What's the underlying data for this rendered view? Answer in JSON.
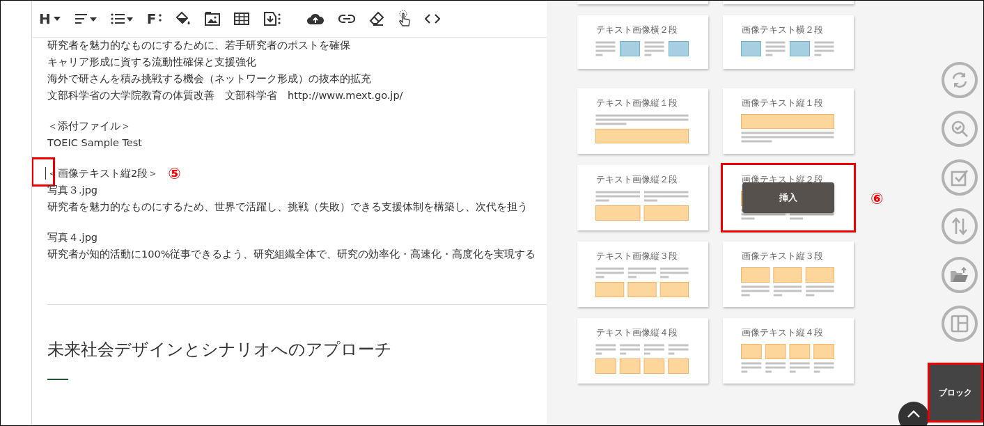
{
  "toolbar": {
    "heading_label": "H",
    "font_label": "F"
  },
  "editor": {
    "paragraphs": [
      {
        "lines": [
          {
            "text": "研究者を魅力的なものにするために、若手研究者のポストを確保",
            "caret": false,
            "highlighted": false
          },
          {
            "text": "キャリア形成に資する流動性確保と支援強化",
            "caret": false,
            "highlighted": false
          },
          {
            "text": "海外で研さんを積み挑戦する機会（ネットワーク形成）の抜本的拡充",
            "caret": false,
            "highlighted": false
          },
          {
            "text": "文部科学省の大学院教育の体質改善　文部科学省　http://www.mext.go.jp/",
            "caret": false,
            "highlighted": false
          }
        ]
      },
      {
        "lines": [
          {
            "text": "＜添付ファイル＞",
            "caret": false,
            "highlighted": false
          },
          {
            "text": "TOEIC Sample Test",
            "caret": false,
            "highlighted": false
          }
        ]
      },
      {
        "lines": [
          {
            "text": "＜画像テキスト縦2段＞",
            "caret": true,
            "highlighted": true,
            "callout": "⑤"
          },
          {
            "text": "写真３.jpg",
            "caret": false,
            "highlighted": false
          },
          {
            "text": "研究者を魅力的なものにするため、世界で活躍し、挑戦（失敗）できる支援体制を構築し、次代を担う",
            "caret": false,
            "highlighted": false
          }
        ]
      },
      {
        "lines": [
          {
            "text": "写真４.jpg",
            "caret": false,
            "highlighted": false
          },
          {
            "text": "研究者が知的活動に100%従事できるよう、研究組織全体で、研究の効率化・高速化・高度化を実現する",
            "caret": false,
            "highlighted": false
          }
        ]
      }
    ],
    "heading": "未来社会デザインとシナリオへのアプローチ"
  },
  "templates": {
    "insert_label": "挿入",
    "cards": [
      {
        "title": "テキスト画像横２段",
        "kind": "horizontal",
        "cells": [
          {
            "kind": "text"
          },
          {
            "kind": "image"
          },
          {
            "kind": "text"
          },
          {
            "kind": "image"
          }
        ],
        "hovered": false,
        "highlighted": false
      },
      {
        "title": "画像テキスト横２段",
        "kind": "horizontal",
        "cells": [
          {
            "kind": "image"
          },
          {
            "kind": "text"
          },
          {
            "kind": "image"
          },
          {
            "kind": "text"
          }
        ],
        "hovered": false,
        "highlighted": false
      },
      {
        "title": "テキスト画像縦１段",
        "kind": "vertical",
        "cells": [
          {
            "kind": "textfirst"
          }
        ],
        "hovered": false,
        "highlighted": false
      },
      {
        "title": "画像テキスト縦１段",
        "kind": "vertical",
        "cells": [
          {
            "kind": "imagefirst"
          }
        ],
        "hovered": false,
        "highlighted": false
      },
      {
        "title": "テキスト画像縦２段",
        "kind": "vertical",
        "cells": [
          {
            "kind": "textfirst"
          },
          {
            "kind": "textfirst"
          }
        ],
        "hovered": false,
        "highlighted": false
      },
      {
        "title": "画像テキスト縦２段",
        "kind": "vertical",
        "cells": [
          {
            "kind": "imagefirst"
          },
          {
            "kind": "imagefirst"
          }
        ],
        "hovered": true,
        "highlighted": true,
        "callout": "⑥"
      },
      {
        "title": "テキスト画像縦３段",
        "kind": "vertical",
        "cells": [
          {
            "kind": "textfirst"
          },
          {
            "kind": "textfirst"
          },
          {
            "kind": "textfirst"
          }
        ],
        "hovered": false,
        "highlighted": false
      },
      {
        "title": "画像テキスト縦３段",
        "kind": "vertical",
        "cells": [
          {
            "kind": "imagefirst"
          },
          {
            "kind": "imagefirst"
          },
          {
            "kind": "imagefirst"
          }
        ],
        "hovered": false,
        "highlighted": false
      },
      {
        "title": "テキスト画像縦４段",
        "kind": "vertical",
        "cells": [
          {
            "kind": "textfirst"
          },
          {
            "kind": "textfirst"
          },
          {
            "kind": "textfirst"
          },
          {
            "kind": "textfirst"
          }
        ],
        "hovered": false,
        "highlighted": false
      },
      {
        "title": "画像テキスト縦４段",
        "kind": "vertical",
        "cells": [
          {
            "kind": "imagefirst"
          },
          {
            "kind": "imagefirst"
          },
          {
            "kind": "imagefirst"
          },
          {
            "kind": "imagefirst"
          }
        ],
        "hovered": false,
        "highlighted": false
      }
    ]
  },
  "block_button": {
    "label": "ブロック",
    "highlighted": true
  }
}
